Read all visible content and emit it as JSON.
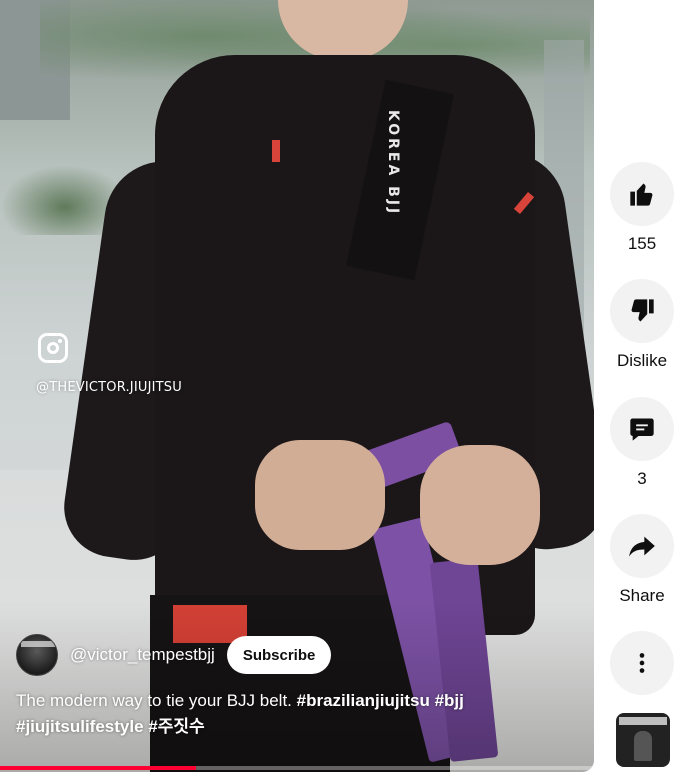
{
  "video": {
    "watermark_handle": "@THEVICTOR.JIUJITSU",
    "gi_lapel_text": "KOREA BJJ",
    "channel": {
      "handle": "@victor_tempestbjj",
      "subscribe_label": "Subscribe"
    },
    "caption": {
      "text": "The modern way to tie your BJJ belt.",
      "hashtags": [
        "#brazilianjiujitsu",
        "#bjj",
        "#jiujitsulifestyle",
        "#주짓수"
      ]
    },
    "progress_fraction": 0.33,
    "progress_color": "#ff0033"
  },
  "actions": {
    "like": {
      "icon": "thumbs-up-icon",
      "label": "155"
    },
    "dislike": {
      "icon": "thumbs-down-icon",
      "label": "Dislike"
    },
    "comments": {
      "icon": "comment-icon",
      "label": "3"
    },
    "share": {
      "icon": "share-icon",
      "label": "Share"
    },
    "more": {
      "icon": "more-vertical-icon"
    },
    "remix": {
      "icon": "remix-thumbnail"
    }
  }
}
